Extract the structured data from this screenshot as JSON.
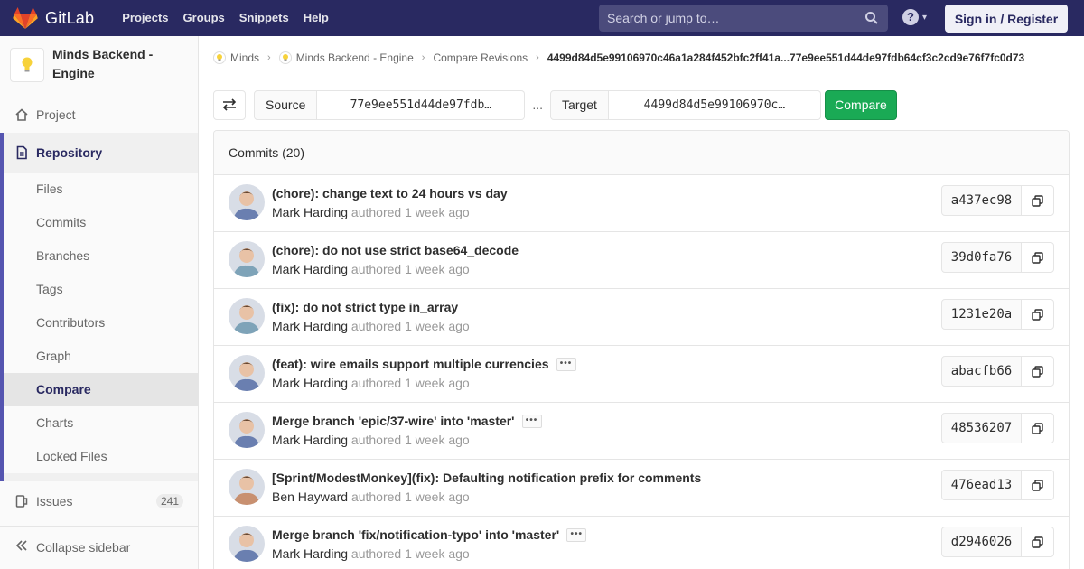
{
  "app": {
    "name": "GitLab"
  },
  "nav": {
    "links": [
      "Projects",
      "Groups",
      "Snippets",
      "Help"
    ],
    "search_placeholder": "Search or jump to…",
    "signin": "Sign in / Register"
  },
  "sidebar": {
    "project_name": "Minds Backend - Engine",
    "project_label": "Project",
    "repository_label": "Repository",
    "repo_items": [
      "Files",
      "Commits",
      "Branches",
      "Tags",
      "Contributors",
      "Graph",
      "Compare",
      "Charts",
      "Locked Files"
    ],
    "active_item": "Compare",
    "issues_label": "Issues",
    "issues_count": "241",
    "collapse_label": "Collapse sidebar"
  },
  "breadcrumb": {
    "items": [
      "Minds",
      "Minds Backend - Engine",
      "Compare Revisions"
    ],
    "current": "4499d84d5e99106970c46a1a284f452bfc2ff41a...77e9ee551d44de97fdb64cf3c2cd9e76f7fc0d73"
  },
  "compare": {
    "source_label": "Source",
    "source_value": "77e9ee551d44de97fdb…",
    "dots": "...",
    "target_label": "Target",
    "target_value": "4499d84d5e99106970c…",
    "button": "Compare"
  },
  "commits": {
    "header": "Commits (20)",
    "authored_word": "authored",
    "items": [
      {
        "title": "(chore): change text to 24 hours vs day",
        "author": "Mark Harding",
        "time": "1 week ago",
        "sha": "a437ec98",
        "has_more": false,
        "avatar_color": "#6a7fb0"
      },
      {
        "title": "(chore): do not use strict base64_decode",
        "author": "Mark Harding",
        "time": "1 week ago",
        "sha": "39d0fa76",
        "has_more": false,
        "avatar_color": "#7ea3b8"
      },
      {
        "title": "(fix): do not strict type in_array",
        "author": "Mark Harding",
        "time": "1 week ago",
        "sha": "1231e20a",
        "has_more": false,
        "avatar_color": "#7ea3b8"
      },
      {
        "title": "(feat): wire emails support multiple currencies",
        "author": "Mark Harding",
        "time": "1 week ago",
        "sha": "abacfb66",
        "has_more": true,
        "avatar_color": "#6a7fb0"
      },
      {
        "title": "Merge branch 'epic/37-wire' into 'master'",
        "author": "Mark Harding",
        "time": "1 week ago",
        "sha": "48536207",
        "has_more": true,
        "avatar_color": "#6a7fb0"
      },
      {
        "title": "[Sprint/ModestMonkey](fix): Defaulting notification prefix for comments",
        "author": "Ben Hayward",
        "time": "1 week ago",
        "sha": "476ead13",
        "has_more": false,
        "avatar_color": "#c89070"
      },
      {
        "title": "Merge branch 'fix/notification-typo' into 'master'",
        "author": "Mark Harding",
        "time": "1 week ago",
        "sha": "d2946026",
        "has_more": true,
        "avatar_color": "#6a7fb0"
      }
    ]
  }
}
